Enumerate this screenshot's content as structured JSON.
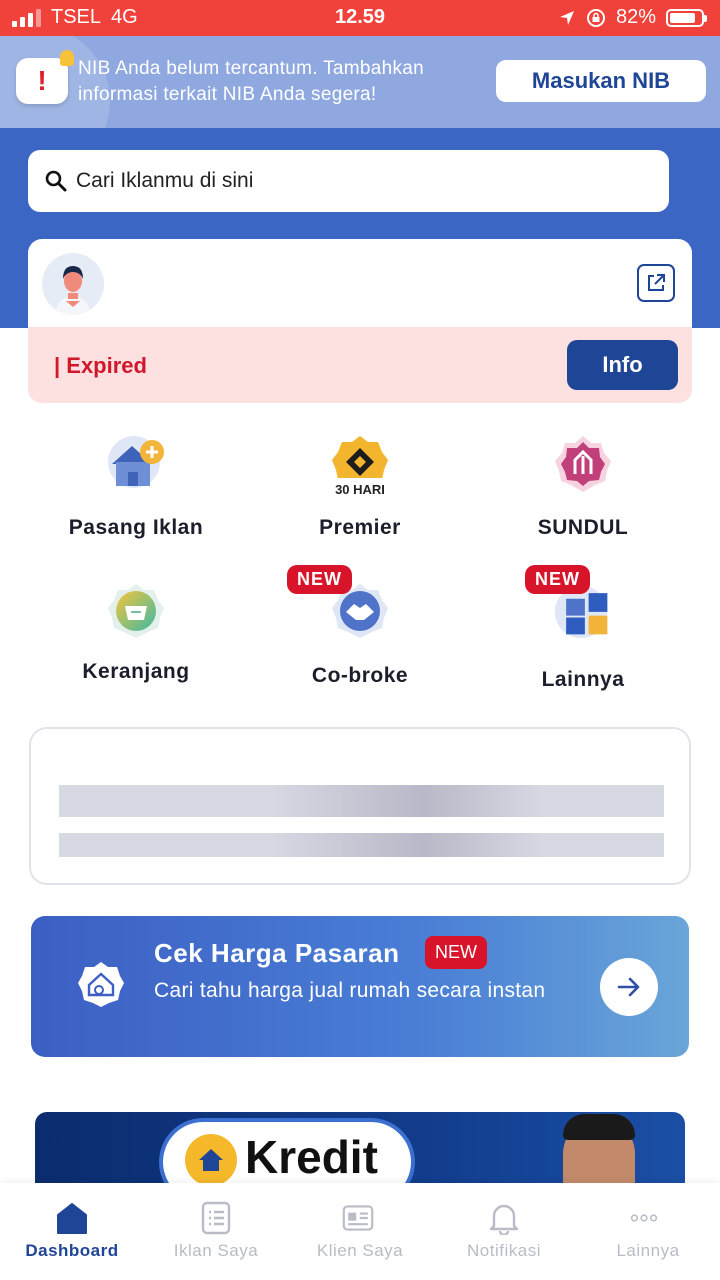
{
  "status_bar": {
    "carrier": "TSEL",
    "network": "4G",
    "time": "12.59",
    "battery": "82%",
    "battery_level": 0.82
  },
  "nib_banner": {
    "message": "NIB Anda belum tercantum. Tambahkan informasi terkait NIB Anda segera!",
    "button_label": "Masukan NIB",
    "icon": "alert-bell-icon"
  },
  "search": {
    "placeholder": "Cari Iklanmu di sini",
    "icon": "search-icon"
  },
  "profile_card": {
    "status_text": "| Expired",
    "info_button": "Info",
    "share_icon": "share-icon"
  },
  "menu": {
    "items": [
      {
        "label": "Pasang Iklan",
        "icon": "house-plus-icon"
      },
      {
        "label": "Premier",
        "icon": "premier-badge-icon",
        "icon_caption": "30 HARI"
      },
      {
        "label": "SUNDUL",
        "icon": "bump-up-icon"
      },
      {
        "label": "Keranjang",
        "icon": "basket-icon"
      },
      {
        "label": "Co-broke",
        "icon": "handshake-icon",
        "badge": "NEW"
      },
      {
        "label": "Lainnya",
        "icon": "grid-apps-icon",
        "badge": "NEW"
      }
    ]
  },
  "cek_harga": {
    "title": "Cek Harga Pasaran",
    "badge": "NEW",
    "subtitle": "Cari tahu harga jual rumah secara instan",
    "icon": "house-price-icon",
    "arrow_icon": "arrow-right-icon"
  },
  "kredit_banner": {
    "title": "Kredit"
  },
  "bottom_nav": {
    "items": [
      {
        "label": "Dashboard",
        "icon": "home-icon",
        "active": true
      },
      {
        "label": "Iklan Saya",
        "icon": "list-doc-icon",
        "active": false
      },
      {
        "label": "Klien Saya",
        "icon": "id-card-icon",
        "active": false
      },
      {
        "label": "Notifikasi",
        "icon": "bell-icon",
        "active": false
      },
      {
        "label": "Lainnya",
        "icon": "more-dots-icon",
        "active": false
      }
    ]
  },
  "colors": {
    "status_bar": "#f0413a",
    "primary": "#1f4597",
    "hero_blue": "#3b66c4",
    "alert_red": "#d0182b",
    "new_badge": "#d8142a"
  }
}
